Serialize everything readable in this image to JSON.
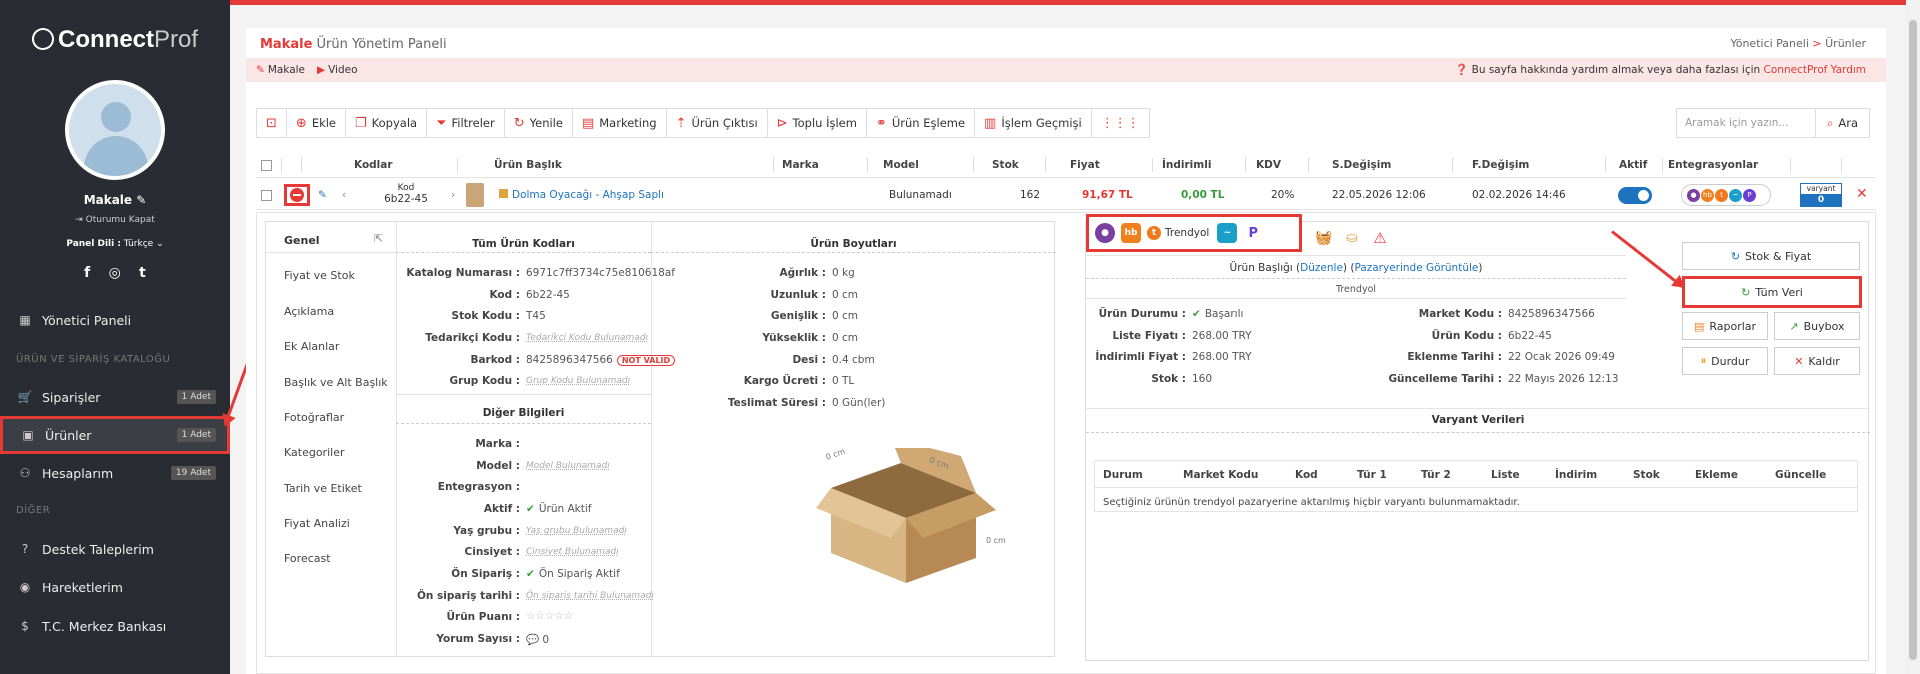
{
  "brand": {
    "name_bold": "Connect",
    "name_light": "Prof"
  },
  "user": {
    "name": "Makale",
    "logout": "Oturumu Kapat",
    "lang_label": "Panel Dili :",
    "lang_value": "Türkçe"
  },
  "social": {
    "facebook": "f",
    "instagram": "◎",
    "twitter": "t"
  },
  "sidebar": {
    "dashboard": "Yönetici Paneli",
    "section1": "ÜRÜN VE SİPARİŞ KATALOĞU",
    "orders": "Siparişler",
    "orders_badge": "1 Adet",
    "products": "Ürünler",
    "products_badge": "1 Adet",
    "accounts": "Hesaplarım",
    "accounts_badge": "19 Adet",
    "section2": "DİĞER",
    "support": "Destek Taleplerim",
    "movements": "Hareketlerim",
    "bank": "T.C. Merkez Bankası"
  },
  "header": {
    "title_red": "Makale",
    "title": "Ürün Yönetim Paneli",
    "bc1": "Yönetici Paneli",
    "bc_sep": ">",
    "bc2": "Ürünler"
  },
  "help": {
    "makale": "Makale",
    "video": "Video",
    "text": "Bu sayfa hakkında yardım almak veya daha fazlası için",
    "link": "ConnectProf Yardım"
  },
  "toolbar": {
    "add": "Ekle",
    "copy": "Kopyala",
    "filter": "Filtreler",
    "refresh": "Yenile",
    "marketing": "Marketing",
    "export": "Ürün Çıktısı",
    "bulk": "Toplu İşlem",
    "match": "Ürün Eşleme",
    "history": "İşlem Geçmişi"
  },
  "search": {
    "placeholder": "Aramak için yazın...",
    "button": "Ara"
  },
  "table": {
    "headers": [
      "Kodlar",
      "Ürün Başlık",
      "Marka",
      "Model",
      "Stok",
      "Fiyat",
      "İndirimli",
      "KDV",
      "S.Değişim",
      "F.Değişim",
      "Aktif",
      "Entegrasyonlar"
    ],
    "row": {
      "kod_label": "Kod",
      "kod": "6b22-45",
      "name": "Dolma Oyacağı - Ahşap Saplı",
      "model": "Bulunamadı",
      "stok": "162",
      "fiyat": "91,67 TL",
      "indirimli": "0,00 TL",
      "kdv": "20%",
      "sdeg": "22.05.2026 12:06",
      "fdeg": "02.02.2026 14:46",
      "varyant_label": "varyant",
      "varyant_count": "0"
    }
  },
  "tabs": [
    "Genel",
    "Fiyat ve Stok",
    "Açıklama",
    "Ek Alanlar",
    "Başlık ve Alt Başlık",
    "Fotoğraflar",
    "Kategoriler",
    "Tarih ve Etiket",
    "Fiyat Analizi",
    "Forecast"
  ],
  "codes": {
    "title": "Tüm Ürün Kodları",
    "katalog_l": "Katalog Numarası :",
    "katalog": "6971c7ff3734c75e810618af",
    "kod_l": "Kod :",
    "kod": "6b22-45",
    "stokkodu_l": "Stok Kodu :",
    "stokkodu": "T45",
    "tedarikci_l": "Tedarikçi Kodu :",
    "tedarikci": "Tedarikçi Kodu Bulunamadı",
    "barkod_l": "Barkod :",
    "barkod": "8425896347566",
    "barkod_badge": "NOT VALID",
    "grup_l": "Grup Kodu :",
    "grup": "Grup Kodu Bulunamadı"
  },
  "other": {
    "title": "Diğer Bilgileri",
    "marka_l": "Marka :",
    "model_l": "Model :",
    "model": "Model Bulunamadı",
    "entegrasyon_l": "Entegrasyon :",
    "aktif_l": "Aktif :",
    "aktif": "Ürün Aktif",
    "yas_l": "Yaş grubu :",
    "yas": "Yaş grubu Bulunamadı",
    "cins_l": "Cinsiyet :",
    "cins": "Cinsiyet Bulunamadı",
    "onsip_l": "Ön Sipariş :",
    "onsip": "Ön Sipariş Aktif",
    "ontarih_l": "Ön sipariş tarihi :",
    "ontarih": "Ön sipariş tarihi Bulunamadı",
    "puan_l": "Ürün Puanı :",
    "puan": "☆☆☆☆☆",
    "yorum_l": "Yorum Sayısı :",
    "yorum": "0"
  },
  "dims": {
    "title": "Ürün Boyutları",
    "agirlik_l": "Ağırlık :",
    "agirlik": "0 kg",
    "uzunluk_l": "Uzunluk :",
    "uzunluk": "0 cm",
    "genislik_l": "Genişlik :",
    "genislik": "0 cm",
    "yukseklik_l": "Yükseklik :",
    "yukseklik": "0 cm",
    "desi_l": "Desi :",
    "desi": "0.4 cbm",
    "kargo_l": "Kargo Ücreti :",
    "kargo": "0 TL",
    "teslimat_l": "Teslimat Süresi :",
    "teslimat": "0 Gün(ler)",
    "box_a": "0 cm",
    "box_b": "0 cm",
    "box_c": "0 cm"
  },
  "market": {
    "trendyol": "Trendyol",
    "hb": "hb",
    "title_label": "Ürün Başlığı",
    "edit": "Düzenle",
    "view": "Pazaryerinde Görüntüle",
    "sub": "Trendyol",
    "durum_l": "Ürün Durumu :",
    "durum": "Başarılı",
    "liste_l": "Liste Fiyatı :",
    "liste": "268.00 TRY",
    "indirim_l": "İndirimli Fiyat :",
    "indirim": "268.00 TRY",
    "stok_l": "Stok :",
    "stok": "160",
    "mkod_l": "Market Kodu :",
    "mkod": "8425896347566",
    "ukod_l": "Ürün Kodu :",
    "ukod": "6b22-45",
    "ekle_l": "Eklenme Tarihi :",
    "ekle": "22 Ocak 2026 09:49",
    "guncel_l": "Güncelleme Tarihi :",
    "guncel": "22 Mayıs 2026 12:13"
  },
  "actions": {
    "stock": "Stok & Fiyat",
    "all": "Tüm Veri",
    "reports": "Raporlar",
    "buybox": "Buybox",
    "stop": "Durdur",
    "remove": "Kaldır"
  },
  "variants": {
    "title": "Varyant Verileri",
    "headers": [
      "Durum",
      "Market Kodu",
      "Kod",
      "Tür 1",
      "Tür 2",
      "Liste",
      "İndirim",
      "Stok",
      "Ekleme",
      "Güncelle"
    ],
    "empty": "Seçtiğiniz ürünün trendyol pazaryerine aktarılmış hiçbir varyantı bulunmamaktadır."
  },
  "colors": {
    "accent": "#e53935",
    "link": "#1e73be",
    "sidebar": "#2a2c33"
  }
}
